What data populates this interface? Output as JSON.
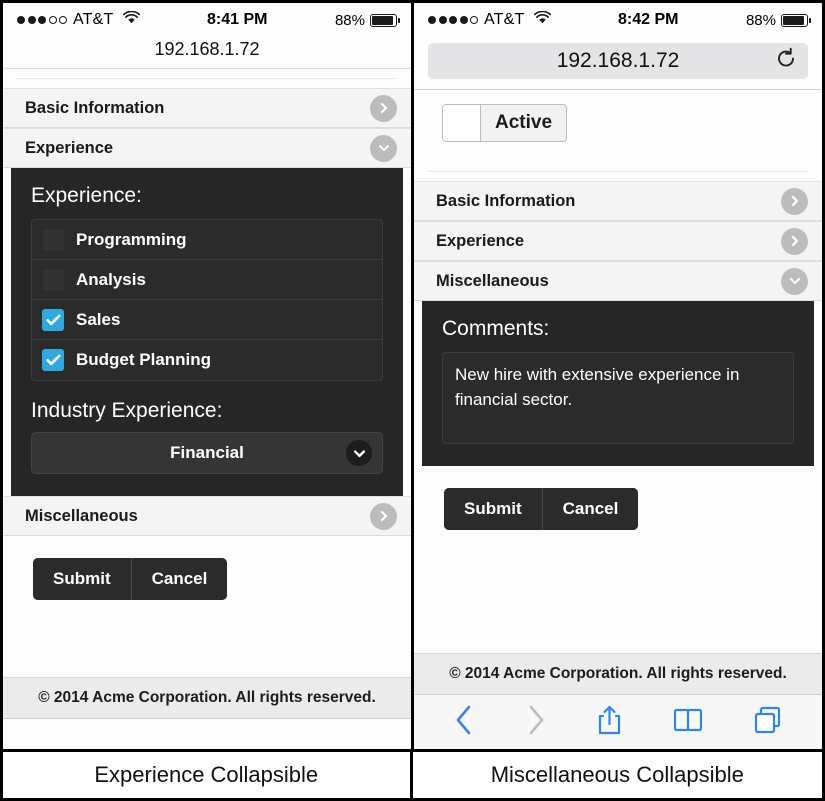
{
  "colors": {
    "accent_checkbox": "#2fa8e0",
    "dark_panel": "#262626",
    "safari_blue": "#2f86e8",
    "chevron_circle": "#bcbcbc"
  },
  "left_panel": {
    "status_bar": {
      "signal_filled": 3,
      "signal_empty": 2,
      "carrier": "AT&T",
      "wifi_icon": "wifi-icon",
      "time": "8:41 PM",
      "battery_percent": "88%",
      "battery_icon": "battery-icon"
    },
    "url": "192.168.1.72",
    "accordion": [
      {
        "label": "Basic Information",
        "state": "collapsed",
        "icon": "chevron-right-icon"
      },
      {
        "label": "Experience",
        "state": "expanded",
        "icon": "chevron-down-icon"
      }
    ],
    "experience_section": {
      "heading": "Experience:",
      "checkboxes": [
        {
          "label": "Programming",
          "checked": false
        },
        {
          "label": "Analysis",
          "checked": false
        },
        {
          "label": "Sales",
          "checked": true
        },
        {
          "label": "Budget Planning",
          "checked": true
        }
      ],
      "select_label": "Industry Experience:",
      "select_value": "Financial",
      "select_icon": "chevron-down-icon"
    },
    "accordion_after": [
      {
        "label": "Miscellaneous",
        "state": "collapsed",
        "icon": "chevron-right-icon"
      }
    ],
    "buttons": {
      "submit": "Submit",
      "cancel": "Cancel"
    },
    "footer": "© 2014 Acme Corporation. All rights reserved.",
    "caption": "Experience Collapsible"
  },
  "right_panel": {
    "status_bar": {
      "signal_filled": 4,
      "signal_empty": 1,
      "carrier": "AT&T",
      "wifi_icon": "wifi-icon",
      "time": "8:42 PM",
      "battery_percent": "88%",
      "battery_icon": "battery-icon"
    },
    "url": "192.168.1.72",
    "reload_icon": "reload-icon",
    "toggle": {
      "label": "Active",
      "on": false
    },
    "accordion": [
      {
        "label": "Basic Information",
        "state": "collapsed",
        "icon": "chevron-right-icon"
      },
      {
        "label": "Experience",
        "state": "collapsed",
        "icon": "chevron-right-icon"
      },
      {
        "label": "Miscellaneous",
        "state": "expanded",
        "icon": "chevron-down-icon"
      }
    ],
    "miscellaneous_section": {
      "heading": "Comments:",
      "comments_value": "New hire with extensive experience in financial sector."
    },
    "buttons": {
      "submit": "Submit",
      "cancel": "Cancel"
    },
    "footer": "© 2014 Acme Corporation. All rights reserved.",
    "safari_toolbar": [
      {
        "icon": "back-icon",
        "enabled": true
      },
      {
        "icon": "forward-icon",
        "enabled": false
      },
      {
        "icon": "share-icon",
        "enabled": true
      },
      {
        "icon": "bookmarks-icon",
        "enabled": true
      },
      {
        "icon": "tabs-icon",
        "enabled": true
      }
    ],
    "caption": "Miscellaneous Collapsible"
  }
}
